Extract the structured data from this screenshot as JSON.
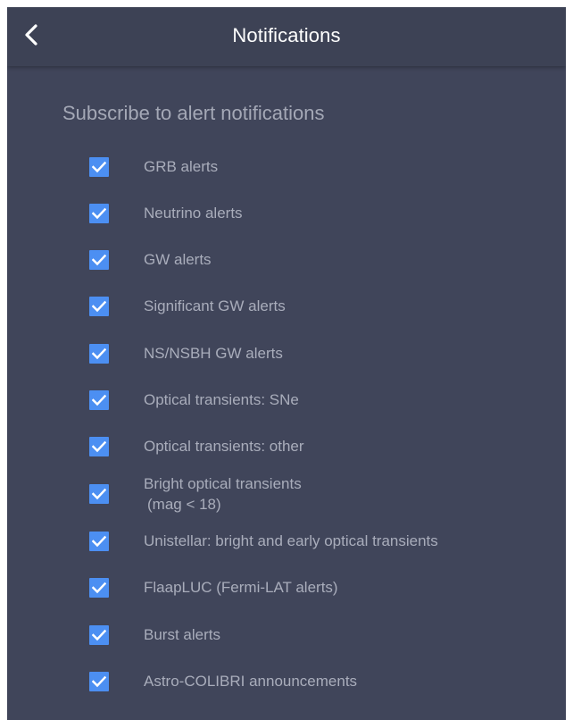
{
  "appbar": {
    "title": "Notifications",
    "back_icon": "chevron-left-icon"
  },
  "section": {
    "title": "Subscribe to alert notifications"
  },
  "colors": {
    "background": "#40455a",
    "appbar": "#3d4255",
    "checkbox": "#4c8ff2",
    "label_text": "#a9adbb"
  },
  "alerts": [
    {
      "name": "grb",
      "label": "GRB alerts",
      "checked": true
    },
    {
      "name": "neutrino",
      "label": "Neutrino alerts",
      "checked": true
    },
    {
      "name": "gw",
      "label": "GW alerts",
      "checked": true
    },
    {
      "name": "significant-gw",
      "label": "Significant GW alerts",
      "checked": true
    },
    {
      "name": "ns-nsbh-gw",
      "label": "NS/NSBH GW alerts",
      "checked": true
    },
    {
      "name": "optical-sne",
      "label": "Optical transients: SNe",
      "checked": true
    },
    {
      "name": "optical-other",
      "label": "Optical transients: other",
      "checked": true
    },
    {
      "name": "bright-optical",
      "label": "Bright optical transients",
      "label_line2": "(mag < 18)",
      "checked": true
    },
    {
      "name": "unistellar",
      "label": "Unistellar: bright and early optical transients",
      "checked": true
    },
    {
      "name": "flaapluc",
      "label": "FlaapLUC (Fermi-LAT alerts)",
      "checked": true
    },
    {
      "name": "burst",
      "label": "Burst alerts",
      "checked": true
    },
    {
      "name": "astro-colibri",
      "label": "Astro-COLIBRI announcements",
      "checked": true
    }
  ]
}
